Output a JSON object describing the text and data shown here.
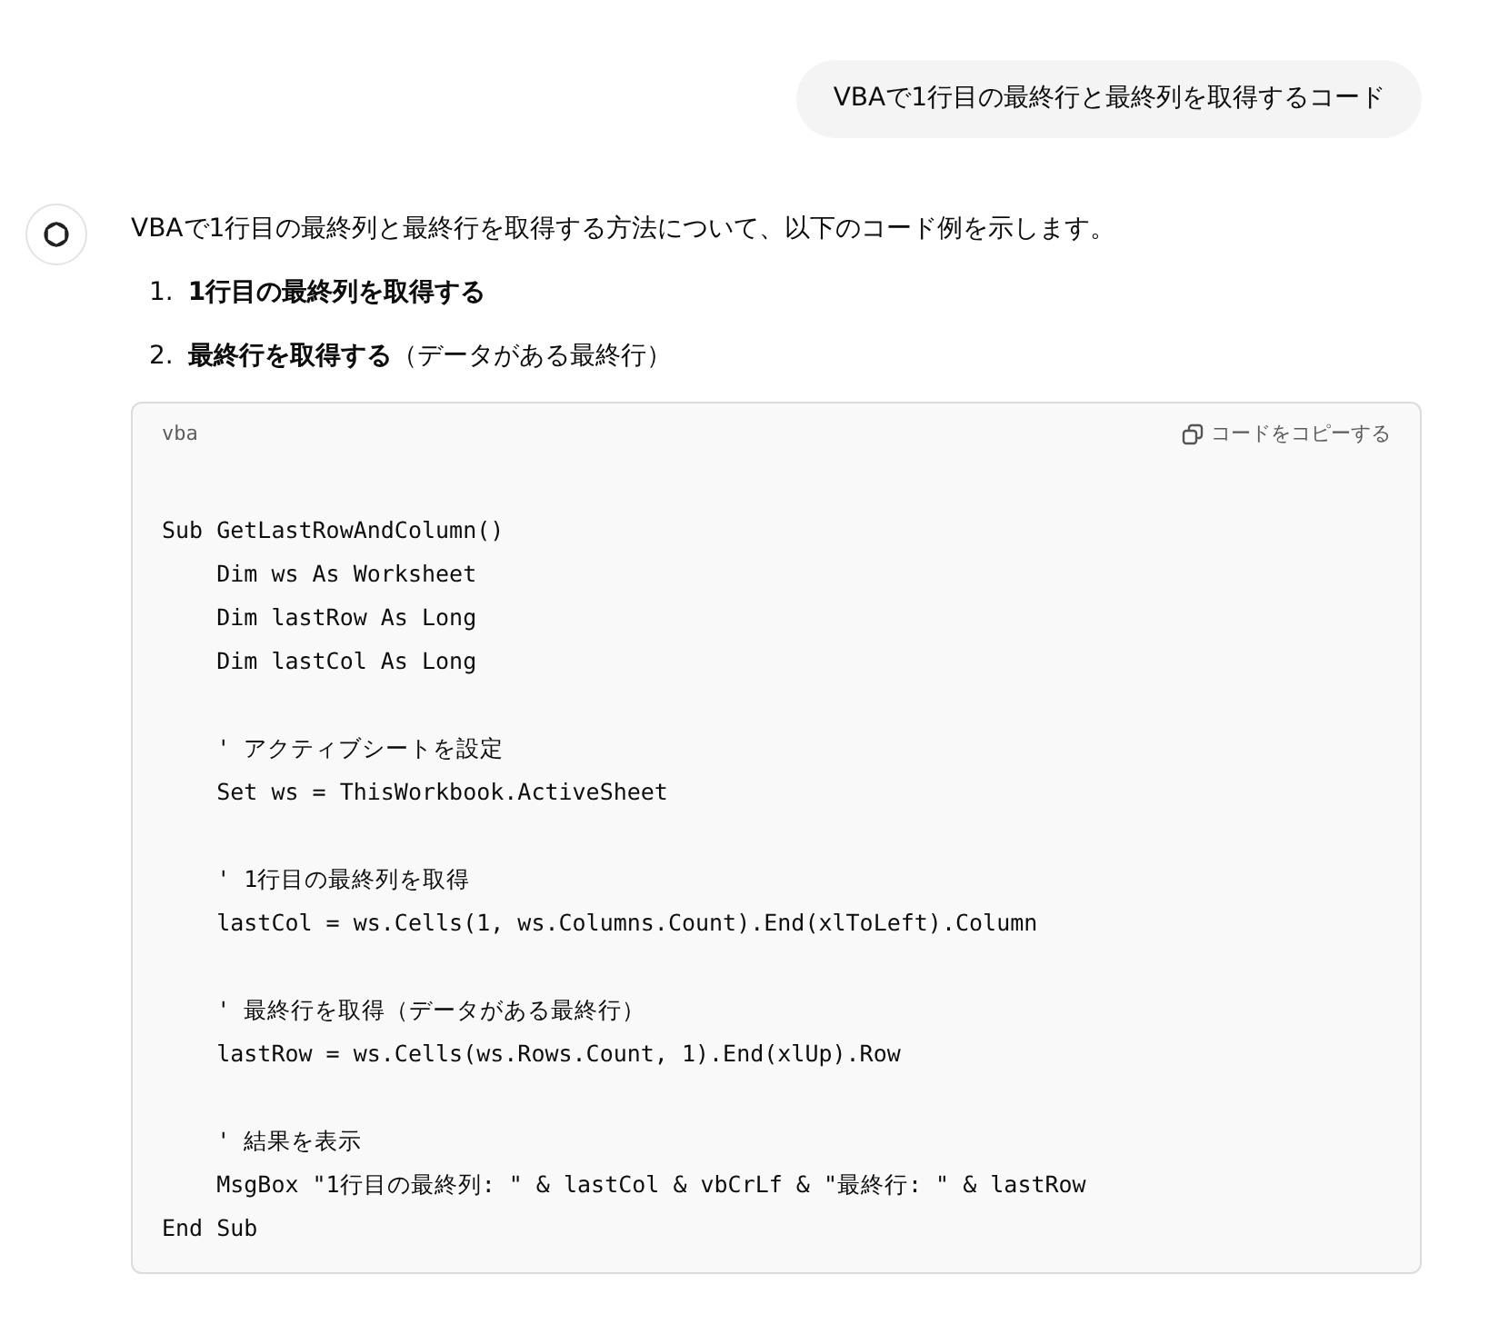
{
  "user_message": "VBAで1行目の最終行と最終列を取得するコード",
  "assistant": {
    "intro": "VBAで1行目の最終列と最終行を取得する方法について、以下のコード例を示します。",
    "steps": [
      {
        "number": "1.",
        "title": "1行目の最終列を取得する"
      },
      {
        "number": "2.",
        "title": "最終行を取得する",
        "note": "（データがある最終行）"
      }
    ],
    "code_block": {
      "language": "vba",
      "copy_label": "コードをコピーする",
      "blocks": [
        [
          "Sub GetLastRowAndColumn()",
          "    Dim ws As Worksheet",
          "    Dim lastRow As Long",
          "    Dim lastCol As Long"
        ],
        [
          "    ' アクティブシートを設定",
          "    Set ws = ThisWorkbook.ActiveSheet"
        ],
        [
          "    ' 1行目の最終列を取得",
          "    lastCol = ws.Cells(1, ws.Columns.Count).End(xlToLeft).Column"
        ],
        [
          "    ' 最終行を取得（データがある最終行）",
          "    lastRow = ws.Cells(ws.Rows.Count, 1).End(xlUp).Row"
        ],
        [
          "    ' 結果を表示",
          "    MsgBox \"1行目の最終列: \" & lastCol & vbCrLf & \"最終行: \" & lastRow",
          "End Sub"
        ]
      ]
    }
  }
}
